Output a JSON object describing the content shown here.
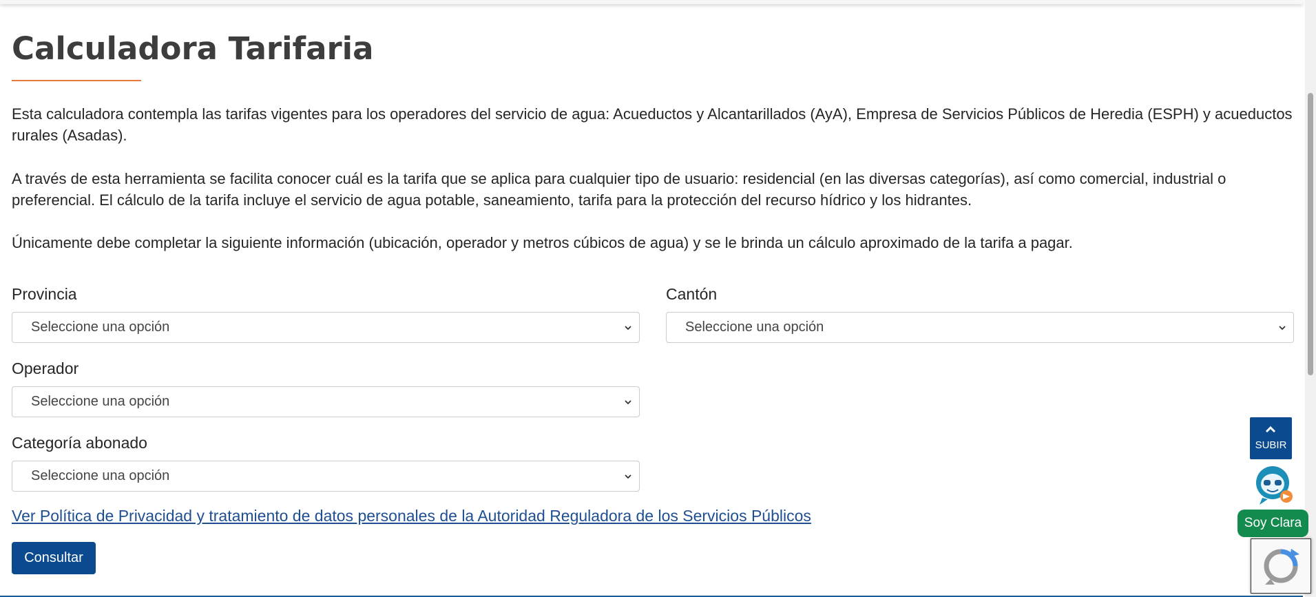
{
  "page": {
    "title": "Calculadora Tarifaria",
    "paragraphs": [
      "Esta calculadora contempla las tarifas vigentes para los operadores del servicio de agua: Acueductos y Alcantarillados (AyA), Empresa de Servicios Públicos de Heredia (ESPH) y acueductos rurales (Asadas).",
      "A través de esta herramienta se facilita conocer cuál es la tarifa que se aplica para cualquier tipo de usuario: residencial (en las diversas categorías), así como comercial, industrial o preferencial. El cálculo de la tarifa incluye el servicio de agua potable, saneamiento, tarifa para la protección del recurso  hídrico y los hidrantes.",
      "Únicamente debe completar la siguiente información (ubicación, operador y metros cúbicos de agua) y se le brinda un cálculo aproximado de la tarifa a pagar."
    ]
  },
  "form": {
    "provincia": {
      "label": "Provincia",
      "value": "Seleccione una opción"
    },
    "canton": {
      "label": "Cantón",
      "value": "Seleccione una opción"
    },
    "operador": {
      "label": "Operador",
      "value": "Seleccione una opción"
    },
    "categoria": {
      "label": "Categoría abonado",
      "value": "Seleccione una opción"
    },
    "privacy_link": "Ver Política de Privacidad y tratamiento de datos personales de la Autoridad Reguladora de los Servicios Públicos",
    "submit_label": "Consultar"
  },
  "floating": {
    "scroll_top_label": "SUBIR",
    "assistant_label": "Soy Clara",
    "icons": [
      "chevron-up-icon",
      "assistant-avatar-icon",
      "recaptcha-icon",
      "chevron-down-icon"
    ]
  },
  "colors": {
    "accent": "#e8793a",
    "primary": "#0b4a8f",
    "link": "#1f4f93",
    "assistant_green": "#138a4e"
  }
}
